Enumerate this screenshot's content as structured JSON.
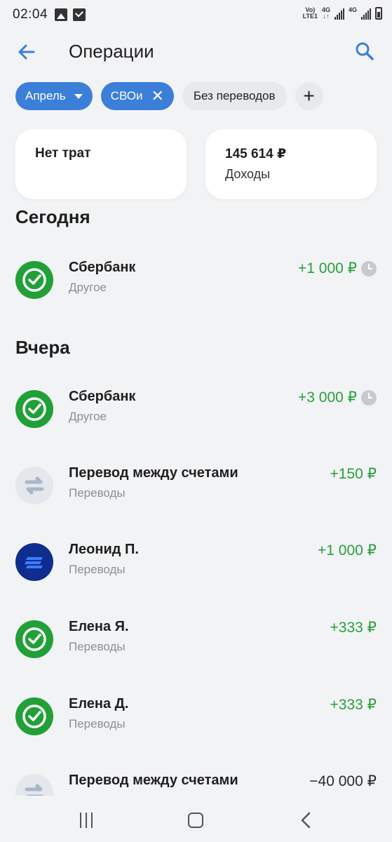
{
  "status_bar": {
    "time": "02:04",
    "net1": "Vo)",
    "net2": "LTE1",
    "net3": "4G",
    "net4": "4G"
  },
  "header": {
    "title": "Операции"
  },
  "filters": {
    "month": "Апрель",
    "category": "СВОи",
    "transfers": "Без переводов"
  },
  "summary": {
    "expenses_label": "Нет трат",
    "income_amount": "145 614 ₽",
    "income_label": "Доходы"
  },
  "sections": {
    "today": "Сегодня",
    "yesterday": "Вчера"
  },
  "today": [
    {
      "name": "Сбербанк",
      "category": "Другое",
      "amount": "+1 000 ₽",
      "icon": "sber-logo-icon",
      "pending": true
    }
  ],
  "yesterday": [
    {
      "name": "Сбербанк",
      "category": "Другое",
      "amount": "+3 000 ₽",
      "icon": "sber-logo-icon",
      "pending": true
    },
    {
      "name": "Перевод между счетами",
      "category": "Переводы",
      "amount": "+150 ₽",
      "icon": "transfer-arrows-icon",
      "pending": false
    },
    {
      "name": "Леонид П.",
      "category": "Переводы",
      "amount": "+1 000 ₽",
      "icon": "bank-stripes-icon",
      "pending": false
    },
    {
      "name": "Елена Я.",
      "category": "Переводы",
      "amount": "+333 ₽",
      "icon": "sber-logo-icon",
      "pending": false
    },
    {
      "name": "Елена Д.",
      "category": "Переводы",
      "amount": "+333 ₽",
      "icon": "sber-logo-icon",
      "pending": false
    },
    {
      "name": "Перевод между счетами",
      "category": "",
      "amount": "−40 000 ₽",
      "icon": "transfer-arrows-icon",
      "pending": false
    }
  ],
  "colors": {
    "accent": "#3b7fd9",
    "positive": "#2a9d3f",
    "sber_green": "#21a038",
    "bank_blue": "#0f2d8f"
  }
}
